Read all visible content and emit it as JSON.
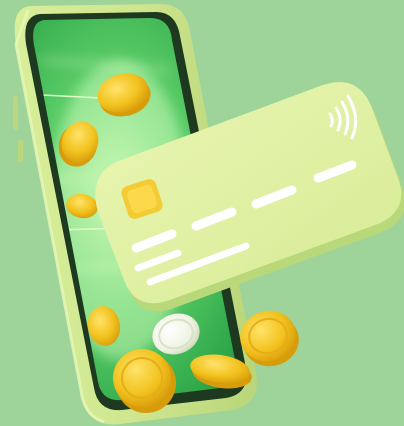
{
  "scene": {
    "background_color": "#9ed49a",
    "phone": {
      "body_color": "#cfe68f",
      "screen_color": "#2fa84a",
      "screen_glow_color": "#b9f2a5",
      "side_buttons": 2
    },
    "card": {
      "body_color": "#e3f2a6",
      "shadow_color": "#b9d87a",
      "chip_color": "#f3cc35",
      "stripe_color": "#ffffff",
      "contactless_icon": "contactless-icon",
      "number_groups": 4,
      "name_lines": 2
    },
    "coins": {
      "gold_color": "#f2c21e",
      "rim_color": "#d79c0c",
      "silver_color": "#f4f7ee",
      "count": 10
    }
  }
}
